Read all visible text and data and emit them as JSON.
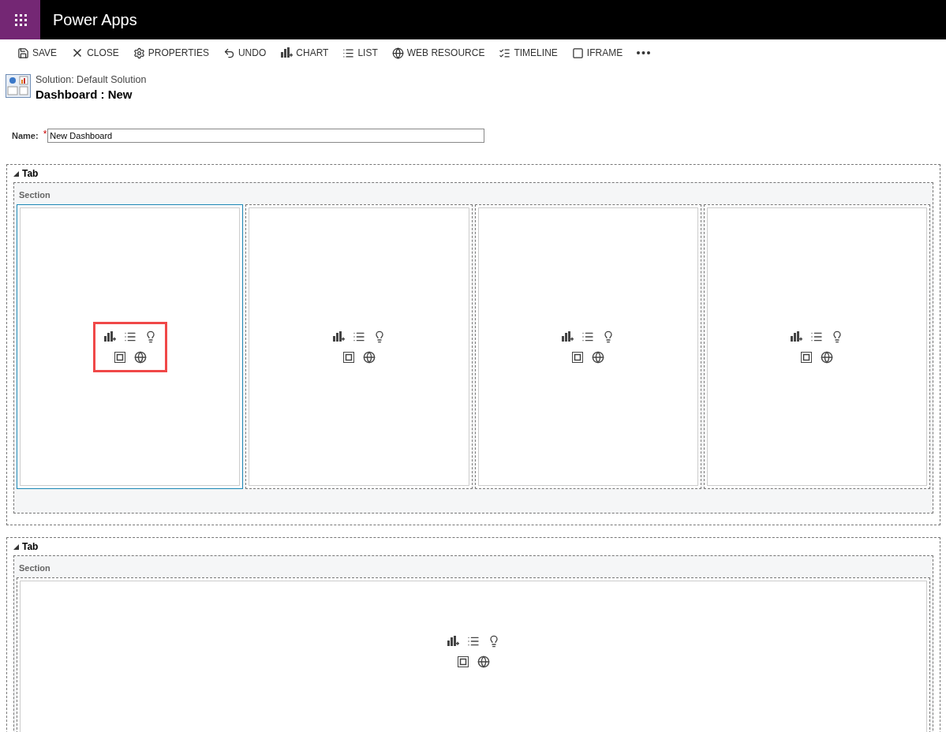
{
  "app": {
    "title": "Power Apps"
  },
  "toolbar": [
    {
      "kind": "save",
      "label": "SAVE"
    },
    {
      "kind": "close",
      "label": "CLOSE"
    },
    {
      "kind": "properties",
      "label": "PROPERTIES"
    },
    {
      "kind": "undo",
      "label": "UNDO"
    },
    {
      "kind": "chart",
      "label": "CHART"
    },
    {
      "kind": "list",
      "label": "LIST"
    },
    {
      "kind": "web",
      "label": "WEB RESOURCE"
    },
    {
      "kind": "timeline",
      "label": "TIMELINE"
    },
    {
      "kind": "iframe",
      "label": "IFRAME"
    },
    {
      "kind": "more"
    }
  ],
  "header": {
    "solution": "Solution: Default Solution",
    "title": "Dashboard : New"
  },
  "name_field": {
    "label": "Name:",
    "required_mark": "*",
    "value": "New Dashboard"
  },
  "tabs": [
    {
      "label": "Tab",
      "expanded": true,
      "section": {
        "label": "Section",
        "cells": [
          {
            "selected": true,
            "highlighted": true
          },
          {
            "selected": false,
            "highlighted": false
          },
          {
            "selected": false,
            "highlighted": false
          },
          {
            "selected": false,
            "highlighted": false
          }
        ]
      }
    },
    {
      "label": "Tab",
      "expanded": true,
      "section": {
        "label": "Section",
        "cells": [
          {
            "selected": false,
            "highlighted": false
          }
        ]
      }
    }
  ]
}
